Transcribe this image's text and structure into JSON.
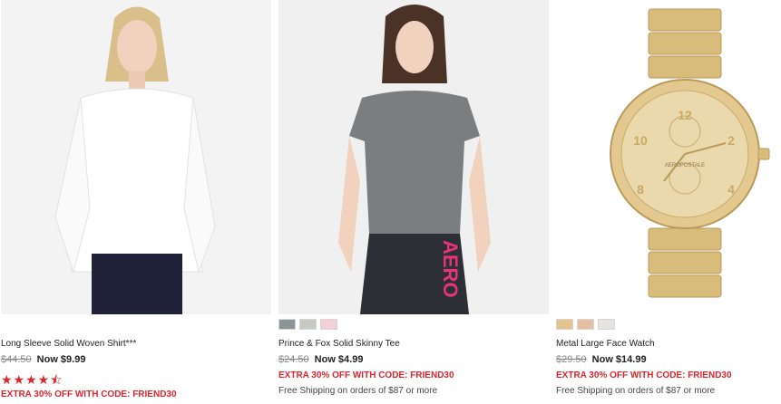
{
  "products": [
    {
      "name": "Long Sleeve Solid Woven Shirt***",
      "was_price": "$44.50",
      "now_price": "Now $9.99",
      "rating_stars": 4.5,
      "rating_glyphs": "★★★★⯪",
      "promo": "EXTRA 30% OFF WITH CODE: FRIEND30"
    },
    {
      "name": "Prince & Fox Solid Skinny Tee",
      "was_price": "$24.50",
      "now_price": "Now $4.99",
      "promo": "EXTRA 30% OFF WITH CODE: FRIEND30",
      "shipping": "Free Shipping on orders of $87 or more",
      "swatch_colors": [
        "#8c9596",
        "#c7c9c3",
        "#f3cfd8"
      ],
      "graphic_text": "AERO"
    },
    {
      "name": "Metal Large Face Watch",
      "was_price": "$29.50",
      "now_price": "Now $14.99",
      "promo": "EXTRA 30% OFF WITH CODE: FRIEND30",
      "shipping": "Free Shipping on orders of $87 or more",
      "swatch_colors": [
        "#e3c48f",
        "#e6bfa2",
        "#e6e4df"
      ],
      "watch_brand": "AEROPOSTALE",
      "dial_numbers": [
        "12",
        "10",
        "2",
        "8",
        "4"
      ]
    }
  ],
  "colors": {
    "promo_red": "#d9262c",
    "gold": "#d8bc7c"
  }
}
